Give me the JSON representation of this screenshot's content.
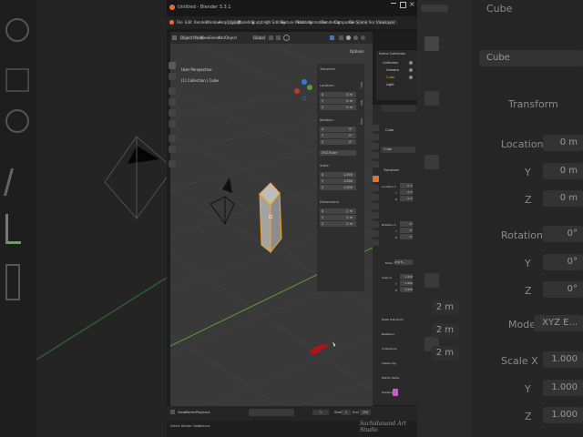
{
  "app": {
    "title": "Untitled - Blender 3.3.1",
    "menus": [
      "File",
      "Edit",
      "Render",
      "Window",
      "Help"
    ],
    "workspaces": [
      "Layout",
      "Modeling",
      "Sculpting",
      "UV Editing",
      "Texture Paint",
      "Shading",
      "Animation",
      "Rendering",
      "Compositing",
      "Geometry Nodes",
      "Scripting"
    ],
    "scene": "Scene",
    "view_layer": "ViewLayer"
  },
  "viewport": {
    "mode": "Object Mode",
    "menus": [
      "View",
      "Select",
      "Add",
      "Object"
    ],
    "transform_orientation": "Global",
    "options": "Options",
    "overlay_title": "User Perspective",
    "overlay_subtitle": "(1) Collection | Cube"
  },
  "npanel": {
    "header": "Transform",
    "location_label": "Location:",
    "location": [
      {
        "axis": "X",
        "value": "0 m"
      },
      {
        "axis": "Y",
        "value": "0 m"
      },
      {
        "axis": "Z",
        "value": "0 m"
      }
    ],
    "rotation_label": "Rotation:",
    "rotation": [
      {
        "axis": "X",
        "value": "0°"
      },
      {
        "axis": "Y",
        "value": "0°"
      },
      {
        "axis": "Z",
        "value": "0°"
      }
    ],
    "rotation_mode": "XYZ Euler",
    "scale_label": "Scale:",
    "scale": [
      {
        "axis": "X",
        "value": "1.000"
      },
      {
        "axis": "Y",
        "value": "1.000"
      },
      {
        "axis": "Z",
        "value": "1.000"
      }
    ],
    "dimensions_label": "Dimensions:",
    "dimensions": [
      {
        "axis": "X",
        "value": "2 m"
      },
      {
        "axis": "Y",
        "value": "2 m"
      },
      {
        "axis": "Z",
        "value": "2 m"
      }
    ],
    "tabs": [
      "Item",
      "Tool",
      "View"
    ]
  },
  "outliner": {
    "root": "Scene Collection",
    "items": [
      "Collection",
      "Camera",
      "Cube",
      "Light"
    ]
  },
  "properties": {
    "object": "Cube",
    "name_field": "Cube",
    "section_transform": "Transform",
    "location_x": "Location X",
    "loc": [
      "0 m",
      "0 m",
      "0 m"
    ],
    "rotation_x": "Rotation X",
    "rot": [
      "0°",
      "0°",
      "0°"
    ],
    "mode_label": "Mode",
    "mode_value": "XYZ E...",
    "scale_x": "Scale X",
    "scale": [
      "1.000",
      "1.000",
      "1.000"
    ],
    "axis_labels": [
      "Y",
      "Z"
    ],
    "sections": [
      "Delta Transform",
      "Relations",
      "Collections",
      "Instancing",
      "Motion Paths",
      "Shading",
      "Visibility"
    ]
  },
  "timeline": {
    "menus": [
      "View",
      "Marker",
      "Playback"
    ],
    "current_frame": "1",
    "start_label": "Start",
    "start": "1",
    "end_label": "End",
    "end": "250"
  },
  "statusbar": {
    "items": [
      "Select",
      "Rotate View",
      "Options"
    ]
  },
  "background_left": {
    "big_icons": [
      "cursor-icon",
      "move-icon",
      "rotate-icon",
      "annotate-icon",
      "measure-icon",
      "add-cube-icon"
    ]
  },
  "background_right": {
    "object": "Cube",
    "field_name": "Cube",
    "transform": "Transform",
    "location_label": "Location X",
    "location_values": [
      "0 m",
      "0 m",
      "0 m"
    ],
    "rotation_label": "Rotation X",
    "rotation_values": [
      "0°",
      "0°",
      "0°"
    ],
    "mode_label": "Mode",
    "mode_value": "XYZ E...",
    "scale_label": "Scale X",
    "scale_values": [
      "1.000",
      "1.000",
      "1.000"
    ],
    "axis_labels": [
      "Y",
      "Z"
    ],
    "dims_values": [
      "2 m",
      "2 m",
      "2 m"
    ]
  },
  "watermark": "Sachidanand Art Studio",
  "colors": {
    "accent": "#e0712e",
    "selection": "#f5a623",
    "x_axis": "#c0392b",
    "y_axis": "#5a9e34",
    "z_axis": "#2f7ddb",
    "annotation": "#b0141b"
  }
}
